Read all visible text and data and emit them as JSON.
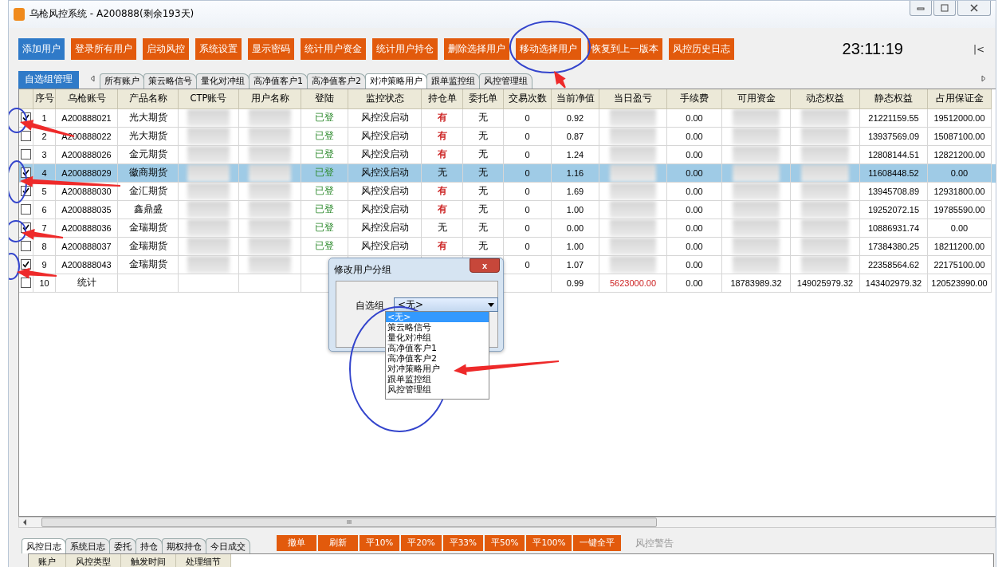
{
  "window": {
    "title": "乌枪风控系统 - A200888(剩余193天)"
  },
  "toolbar": {
    "buttons": [
      {
        "label": "添加用户",
        "kind": "primary"
      },
      {
        "label": "登录所有用户",
        "kind": "action"
      },
      {
        "label": "启动风控",
        "kind": "action"
      },
      {
        "label": "系统设置",
        "kind": "action"
      },
      {
        "label": "显示密码",
        "kind": "action"
      },
      {
        "label": "统计用户资金",
        "kind": "action"
      },
      {
        "label": "统计用户持仓",
        "kind": "action"
      },
      {
        "label": "删除选择用户",
        "kind": "action"
      },
      {
        "label": "移动选择用户",
        "kind": "action"
      },
      {
        "label": "恢复到上一版本",
        "kind": "action"
      },
      {
        "label": "风控历史日志",
        "kind": "action"
      }
    ],
    "clock": "23:11:19",
    "collapse": "|<"
  },
  "group_button": "自选组管理",
  "tabs": [
    {
      "label": "所有账户",
      "selected": false
    },
    {
      "label": "策云略信号",
      "selected": false
    },
    {
      "label": "量化对冲组",
      "selected": false
    },
    {
      "label": "高净值客户1",
      "selected": false
    },
    {
      "label": "高净值客户2",
      "selected": false
    },
    {
      "label": "对冲策略用户",
      "selected": true
    },
    {
      "label": "跟单监控组",
      "selected": false
    },
    {
      "label": "风控管理组",
      "selected": false
    }
  ],
  "table": {
    "columns": [
      {
        "label": "序号",
        "kind": "plain"
      },
      {
        "label": "乌枪账号",
        "kind": "plain"
      },
      {
        "label": "产品名称",
        "kind": "plain"
      },
      {
        "label": "CTP账号",
        "kind": "blurred"
      },
      {
        "label": "用户名称",
        "kind": "blurred"
      },
      {
        "label": "登陆",
        "kind": "login"
      },
      {
        "label": "监控状态",
        "kind": "plain"
      },
      {
        "label": "持仓单",
        "kind": "plain"
      },
      {
        "label": "委托单",
        "kind": "plain"
      },
      {
        "label": "交易次数",
        "kind": "plain"
      },
      {
        "label": "当前净值",
        "kind": "plain"
      },
      {
        "label": "当日盈亏",
        "kind": "blurred"
      },
      {
        "label": "手续费",
        "kind": "plain"
      },
      {
        "label": "可用资金",
        "kind": "blurred"
      },
      {
        "label": "动态权益",
        "kind": "blurred"
      },
      {
        "label": "静态权益",
        "kind": "plain"
      },
      {
        "label": "占用保证金",
        "kind": "plain"
      }
    ],
    "rows": [
      {
        "kind": "account",
        "checked": true,
        "selected": false,
        "cells": [
          "1",
          "A200888021",
          "光大期货",
          null,
          null,
          "已登",
          "风控没启动",
          {
            "text": "有",
            "color": "#cc2222"
          },
          "无",
          "0",
          "0.92",
          null,
          "0.00",
          null,
          null,
          "21221159.55",
          "19512000.00"
        ]
      },
      {
        "kind": "account",
        "checked": false,
        "selected": false,
        "cells": [
          "2",
          "A200888022",
          "光大期货",
          null,
          null,
          "已登",
          "风控没启动",
          {
            "text": "有",
            "color": "#cc2222"
          },
          "无",
          "0",
          "0.87",
          null,
          "0.00",
          null,
          null,
          "13937569.09",
          "15087100.00"
        ]
      },
      {
        "kind": "account",
        "checked": false,
        "selected": false,
        "cells": [
          "3",
          "A200888026",
          "金元期货",
          null,
          null,
          "已登",
          "风控没启动",
          {
            "text": "有",
            "color": "#cc2222"
          },
          "无",
          "0",
          "1.24",
          null,
          "0.00",
          null,
          null,
          "12808144.51",
          "12821200.00"
        ]
      },
      {
        "kind": "account",
        "checked": true,
        "selected": true,
        "cells": [
          "4",
          "A200888029",
          "徽商期货",
          null,
          null,
          "已登",
          "风控没启动",
          "无",
          "无",
          "0",
          "1.16",
          null,
          "0.00",
          null,
          null,
          "11608448.52",
          "0.00"
        ]
      },
      {
        "kind": "account",
        "checked": true,
        "selected": false,
        "cells": [
          "5",
          "A200888030",
          "金汇期货",
          null,
          null,
          "已登",
          "风控没启动",
          {
            "text": "有",
            "color": "#cc2222"
          },
          "无",
          "0",
          "1.69",
          null,
          "0.00",
          null,
          null,
          "13945708.89",
          "12931800.00"
        ]
      },
      {
        "kind": "account",
        "checked": false,
        "selected": false,
        "cells": [
          "6",
          "A200888035",
          "鑫鼎盛",
          null,
          null,
          "已登",
          "风控没启动",
          {
            "text": "有",
            "color": "#cc2222"
          },
          "无",
          "0",
          "1.00",
          null,
          "0.00",
          null,
          null,
          "19252072.15",
          "19785590.00"
        ]
      },
      {
        "kind": "account",
        "checked": true,
        "selected": false,
        "cells": [
          "7",
          "A200888036",
          "金瑞期货",
          null,
          null,
          "已登",
          "风控没启动",
          "无",
          "无",
          "0",
          "0.00",
          null,
          "0.00",
          null,
          null,
          "10886931.74",
          "0.00"
        ]
      },
      {
        "kind": "account",
        "checked": false,
        "selected": false,
        "cells": [
          "8",
          "A200888037",
          "金瑞期货",
          null,
          null,
          "已登",
          "风控没启动",
          {
            "text": "有",
            "color": "#cc2222"
          },
          "无",
          "0",
          "1.00",
          null,
          "0.00",
          null,
          null,
          "17384380.25",
          "18211200.00"
        ]
      },
      {
        "kind": "account",
        "checked": true,
        "selected": false,
        "cells": [
          "9",
          "A200888043",
          "金瑞期货",
          null,
          null,
          null,
          null,
          null,
          null,
          "0",
          "1.07",
          null,
          "0.00",
          null,
          null,
          "22358564.62",
          "22175100.00"
        ]
      },
      {
        "kind": "total",
        "checked": false,
        "selected": false,
        "cells": [
          "10",
          "统计",
          null,
          null,
          null,
          null,
          null,
          null,
          null,
          null,
          "0.99",
          {
            "text": "5623000.00",
            "color": "#cc2222"
          },
          "0.00",
          "18783989.32",
          "149025979.32",
          "143402979.32",
          "120523990.00"
        ]
      }
    ]
  },
  "dialog": {
    "title": "修改用户分组",
    "close": "x",
    "field_label": "自选组",
    "select_value": "<无>",
    "options": [
      {
        "label": "<无>",
        "selected": true
      },
      {
        "label": "策云略信号",
        "selected": false
      },
      {
        "label": "量化对冲组",
        "selected": false
      },
      {
        "label": "高净值客户1",
        "selected": false
      },
      {
        "label": "高净值客户2",
        "selected": false
      },
      {
        "label": "对冲策略用户",
        "selected": false
      },
      {
        "label": "跟单监控组",
        "selected": false
      },
      {
        "label": "风控管理组",
        "selected": false
      }
    ]
  },
  "scrollbar": {
    "grip": "III"
  },
  "bottom_tabs": [
    {
      "label": "风控日志",
      "selected": true
    },
    {
      "label": "系统日志",
      "selected": false
    },
    {
      "label": "委托",
      "selected": false
    },
    {
      "label": "持仓",
      "selected": false
    },
    {
      "label": "期权持仓",
      "selected": false
    },
    {
      "label": "今日成交",
      "selected": false
    }
  ],
  "bottom_buttons": [
    "撤单",
    "刷新",
    "平10%",
    "平20%",
    "平33%",
    "平50%",
    "平100%",
    "一键全平"
  ],
  "warning_label": "风控警告",
  "log_columns": [
    "账户",
    "风控类型",
    "触发时间",
    "处理细节"
  ]
}
